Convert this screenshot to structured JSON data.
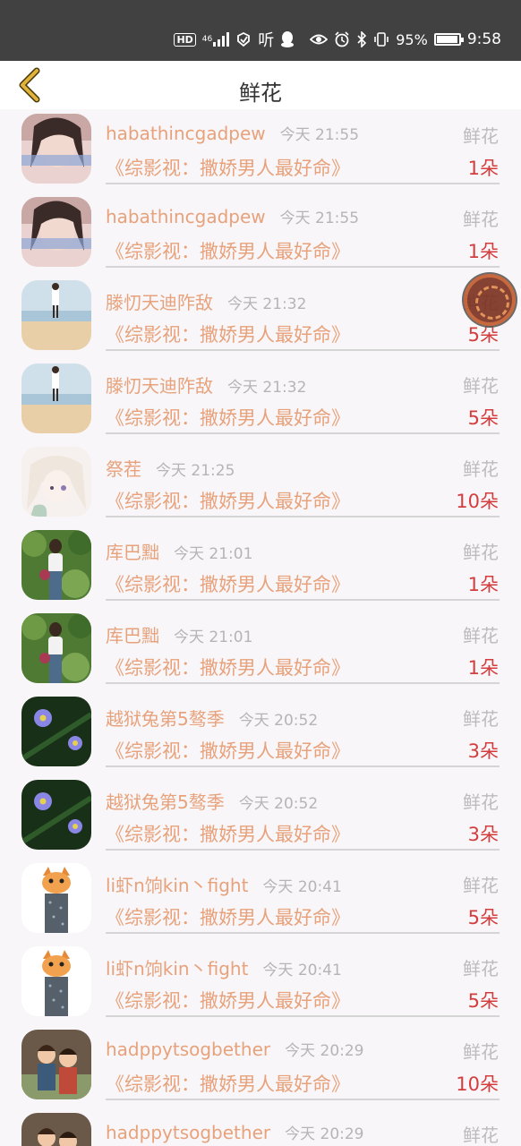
{
  "status_bar": {
    "hd": "HD",
    "network": "46",
    "listen": "听",
    "battery_pct": "95%",
    "battery_level": 0.95,
    "time": "9:58"
  },
  "nav": {
    "title": "鲜花"
  },
  "colors": {
    "accent": "#e7a27c",
    "count": "#d43d3d",
    "muted": "#b5b5b5",
    "status_bar": "#414141",
    "back_arrow": "#e0b43a"
  },
  "rows": [
    {
      "name": "habathincgadpew",
      "time": "今天 21:55",
      "gift": "鲜花",
      "book": "《综影视：撒娇男人最好命》",
      "count": "1朵",
      "avatar": "girl-photo"
    },
    {
      "name": "habathincgadpew",
      "time": "今天 21:55",
      "gift": "鲜花",
      "book": "《综影视：撒娇男人最好命》",
      "count": "1朵",
      "avatar": "girl-photo"
    },
    {
      "name": "滕忉天迪阼敌",
      "time": "今天 21:32",
      "gift": "鲜花",
      "book": "《综影视：撒娇男人最好命》",
      "count": "5朵",
      "avatar": "beach-photo"
    },
    {
      "name": "滕忉天迪阼敌",
      "time": "今天 21:32",
      "gift": "鲜花",
      "book": "《综影视：撒娇男人最好命》",
      "count": "5朵",
      "avatar": "beach-photo"
    },
    {
      "name": "祭茬",
      "time": "今天 21:25",
      "gift": "鲜花",
      "book": "《综影视：撒娇男人最好命》",
      "count": "10朵",
      "avatar": "anime-girl"
    },
    {
      "name": "库巴黜",
      "time": "今天 21:01",
      "gift": "鲜花",
      "book": "《综影视：撒娇男人最好命》",
      "count": "1朵",
      "avatar": "garden-photo"
    },
    {
      "name": "库巴黜",
      "time": "今天 21:01",
      "gift": "鲜花",
      "book": "《综影视：撒娇男人最好命》",
      "count": "1朵",
      "avatar": "garden-photo"
    },
    {
      "name": "越狱兔第5骜季",
      "time": "今天 20:52",
      "gift": "鲜花",
      "book": "《综影视：撒娇男人最好命》",
      "count": "3朵",
      "avatar": "flower-photo"
    },
    {
      "name": "越狱兔第5骜季",
      "time": "今天 20:52",
      "gift": "鲜花",
      "book": "《综影视：撒娇男人最好命》",
      "count": "3朵",
      "avatar": "flower-photo"
    },
    {
      "name": "li虾n饷kin丶fight",
      "time": "今天 20:41",
      "gift": "鲜花",
      "book": "《综影视：撒娇男人最好命》",
      "count": "5朵",
      "avatar": "cat-cartoon"
    },
    {
      "name": "li虾n饷kin丶fight",
      "time": "今天 20:41",
      "gift": "鲜花",
      "book": "《综影视：撒娇男人最好命》",
      "count": "5朵",
      "avatar": "cat-cartoon"
    },
    {
      "name": "hadppytsogbether",
      "time": "今天 20:29",
      "gift": "鲜花",
      "book": "《综影视：撒娇男人最好命》",
      "count": "10朵",
      "avatar": "kids-photo"
    },
    {
      "name": "hadppytsogbether",
      "time": "今天 20:29",
      "gift": "鲜花",
      "book": "",
      "count": "",
      "avatar": "kids-photo"
    }
  ]
}
